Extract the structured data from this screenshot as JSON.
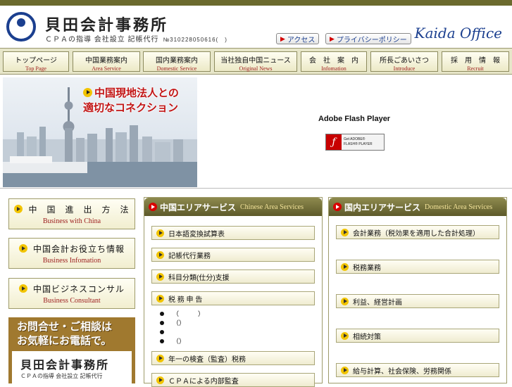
{
  "header": {
    "brand_jp": "貝田会計事務所",
    "brand_sub": "ＣＰＡの指導 会社設立 記帳代行",
    "reg_number": "№310228050616(　)",
    "access_button": "アクセス",
    "privacy_button": "プライバシーポリシー",
    "office_name": "Kaida Office"
  },
  "nav": [
    {
      "jp": "トップページ",
      "en": "Top Page"
    },
    {
      "jp": "中国業務案内",
      "en": "Area Service"
    },
    {
      "jp": "国内業務案内",
      "en": "Domestic Service"
    },
    {
      "jp": "当社独自中国ニュース",
      "en": "Original News"
    },
    {
      "jp": "会　社　案　内",
      "en": "Infomation"
    },
    {
      "jp": "所長ごあいさつ",
      "en": "Introduce"
    },
    {
      "jp": "採　用　情　報",
      "en": "Recruit"
    }
  ],
  "hero": {
    "title_line1": "中国現地法人との",
    "title_line2": "適切なコネクション",
    "flash_label": "Adobe Flash Player",
    "flash_badge_line1": "Get ADOBE®",
    "flash_badge_line2": "FLASH® PLAYER"
  },
  "sidebar": [
    {
      "jp": "中　国　進　出　方　法",
      "en": "Business with China"
    },
    {
      "jp": "中国会計お役立ち情報",
      "en": "Business Infomation"
    },
    {
      "jp": "中国ビジネスコンサル",
      "en": "Business Consultant"
    }
  ],
  "contact": {
    "line1": "お問合せ・ご相談は",
    "line2": "お気軽にお電話で。",
    "card_name": "貝田会計事務所",
    "card_sub": "ＣＰＡの指導 会社設立 記帳代行"
  },
  "china_panel": {
    "title_jp": "中国エリアサービス",
    "title_en": "Chinese Area Services",
    "items": [
      "日本語変換試算表",
      "記帳代行業務",
      "科目分類(仕分)支援",
      "税 務 申 告"
    ],
    "bullets": [
      "（　　　）",
      "（）",
      "",
      "（）"
    ],
    "items2": [
      "年一の検査（監査）税務",
      "ＣＰＡによる内部監査"
    ]
  },
  "domestic_panel": {
    "title_jp": "国内エリアサービス",
    "title_en": "Domestic Area Services",
    "items": [
      "会計業務（税効果を適用した合計処理）",
      "税務業務",
      "利益、経営計画",
      "相続対策",
      "給与計算、社会保険、労務関係"
    ]
  }
}
